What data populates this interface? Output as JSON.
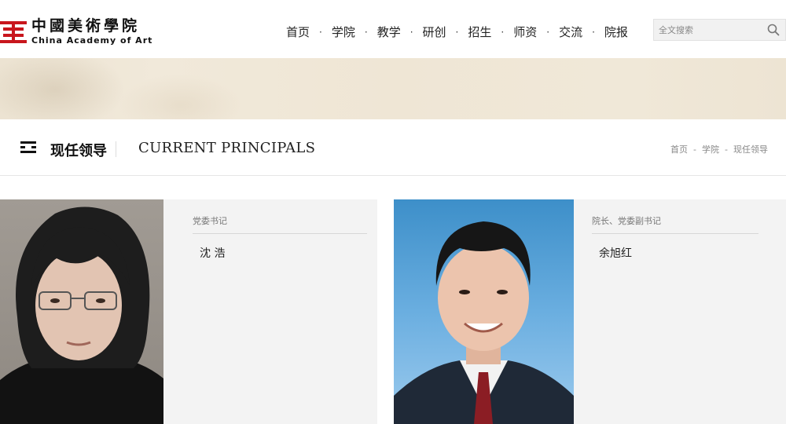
{
  "logo": {
    "name_cn": "中國美術學院",
    "name_en": "China Academy of Art",
    "brand_color": "#c8161d"
  },
  "nav": {
    "items": [
      "首页",
      "学院",
      "教学",
      "研创",
      "招生",
      "师资",
      "交流",
      "院报"
    ],
    "separator": "·"
  },
  "search": {
    "placeholder": "全文搜索",
    "icon": "search-icon"
  },
  "section": {
    "menu_icon": "menu-icon",
    "title_cn": "现任领导",
    "title_en": "CURRENT PRINCIPALS"
  },
  "breadcrumb": {
    "items": [
      "首页",
      "学院",
      "现任领导"
    ],
    "separator": "-"
  },
  "principals": [
    {
      "role": "党委书记",
      "name": "沈  浩"
    },
    {
      "role": "院长、党委副书记",
      "name": "余旭红"
    }
  ]
}
